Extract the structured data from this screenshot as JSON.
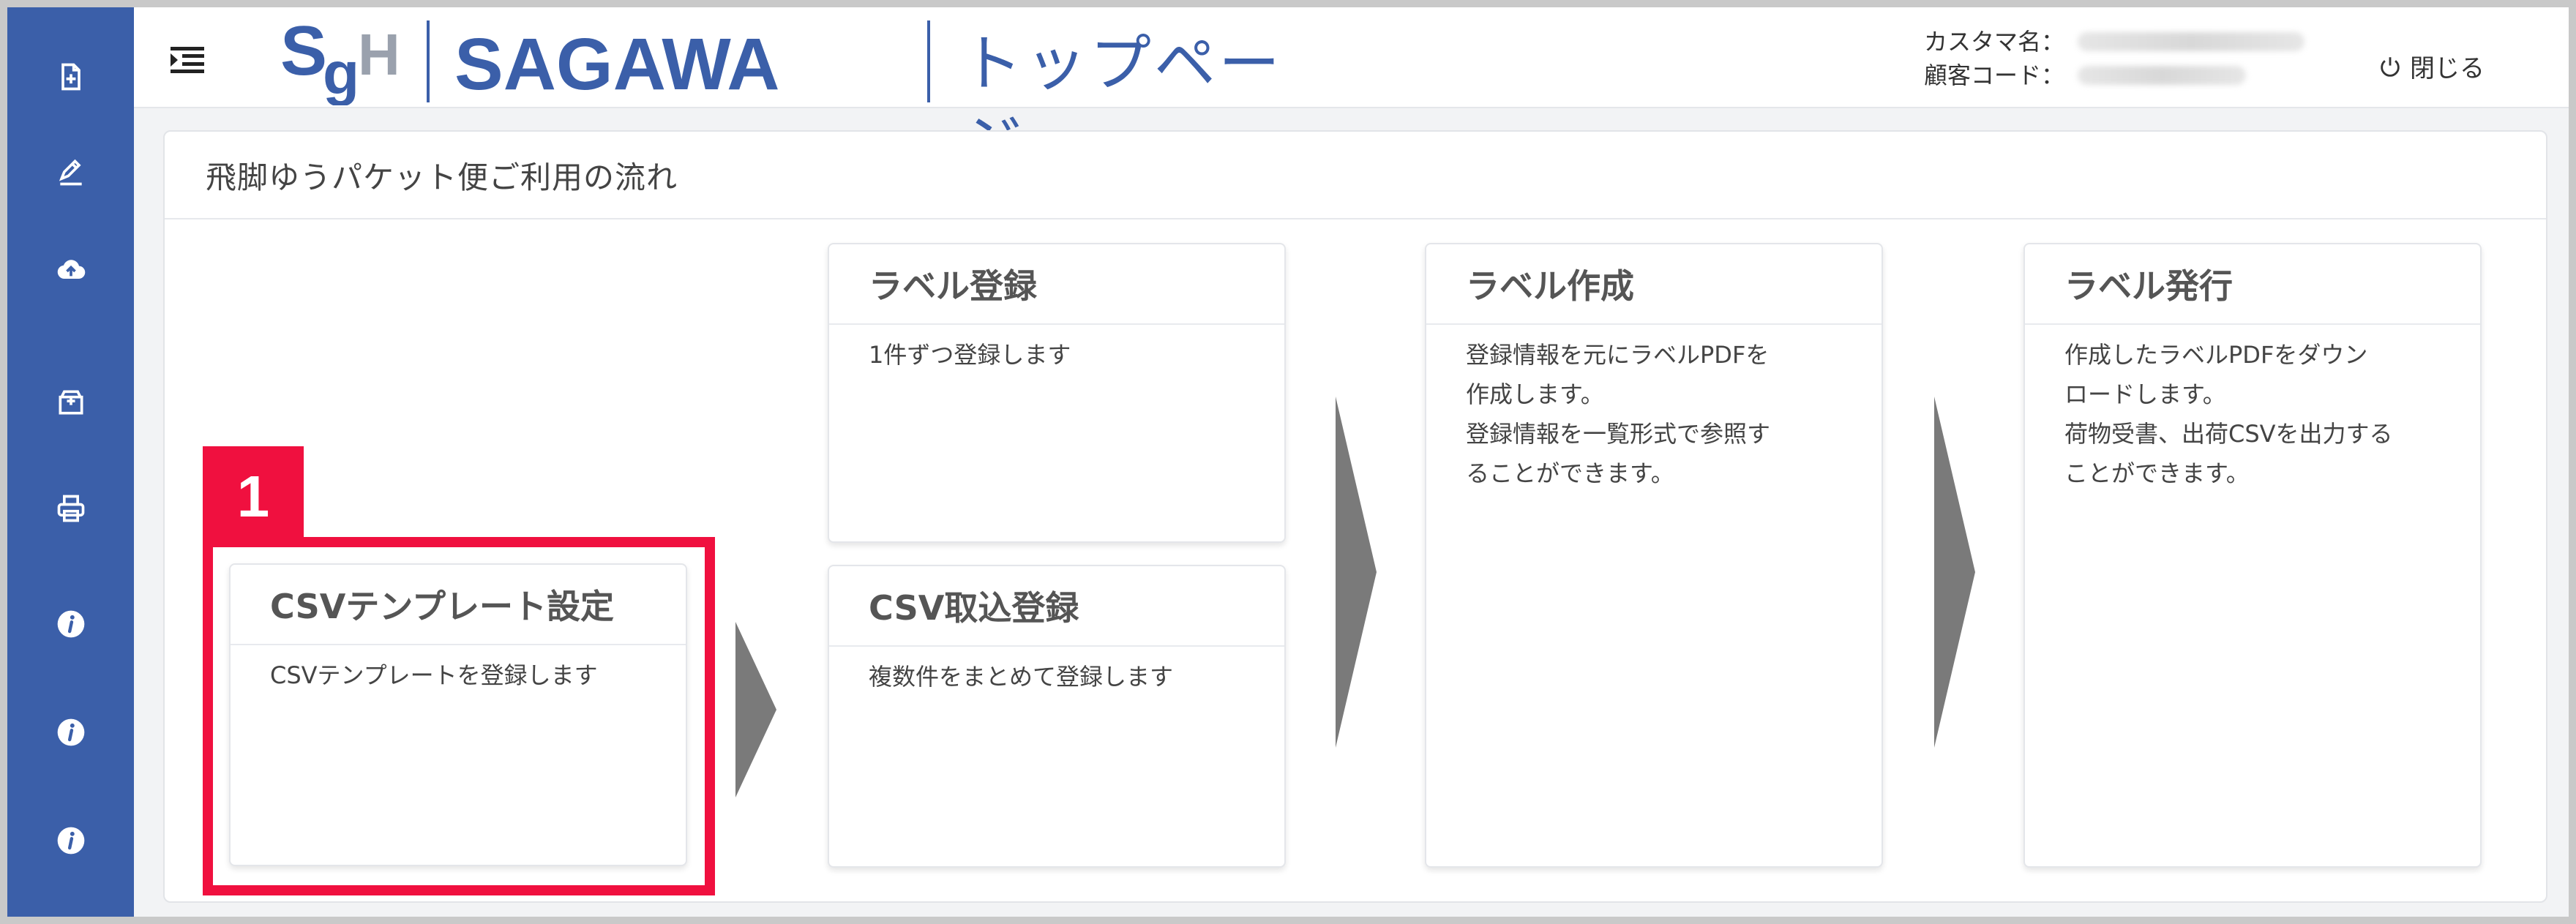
{
  "header": {
    "brand": "SAGAWA",
    "page_title": "トップページ",
    "customer_name_label": "カスタマ名：",
    "customer_code_label": "顧客コード：",
    "close_label": "閉じる"
  },
  "sidebar": {
    "items": [
      {
        "icon": "add-document-icon"
      },
      {
        "icon": "edit-icon"
      },
      {
        "icon": "cloud-upload-icon"
      },
      {
        "icon": "package-icon"
      },
      {
        "icon": "printer-icon"
      },
      {
        "icon": "info-icon"
      },
      {
        "icon": "info-icon"
      },
      {
        "icon": "info-icon"
      }
    ]
  },
  "panel": {
    "title": "飛脚ゆうパケット便ご利用の流れ"
  },
  "cards": {
    "csv_template": {
      "title": "CSVテンプレート設定",
      "desc": "CSVテンプレートを登録します"
    },
    "label_register": {
      "title": "ラベル登録",
      "desc": "1件ずつ登録します"
    },
    "csv_import": {
      "title": "CSV取込登録",
      "desc": "複数件をまとめて登録します"
    },
    "label_create": {
      "title": "ラベル作成",
      "desc_lines": [
        "登録情報を元にラベルPDFを",
        "作成します。",
        "登録情報を一覧形式で参照す",
        "ることができます。"
      ]
    },
    "label_issue": {
      "title": "ラベル発行",
      "desc_lines": [
        "作成したラベルPDFをダウン",
        "ロードします。",
        "荷物受書、出荷CSVを出力する",
        "ことができます。"
      ]
    }
  },
  "annotation": {
    "step_number": "1",
    "color": "#f0103f"
  },
  "colors": {
    "brand_blue": "#3b5fa9",
    "arrow_gray": "#7a7a7a"
  }
}
